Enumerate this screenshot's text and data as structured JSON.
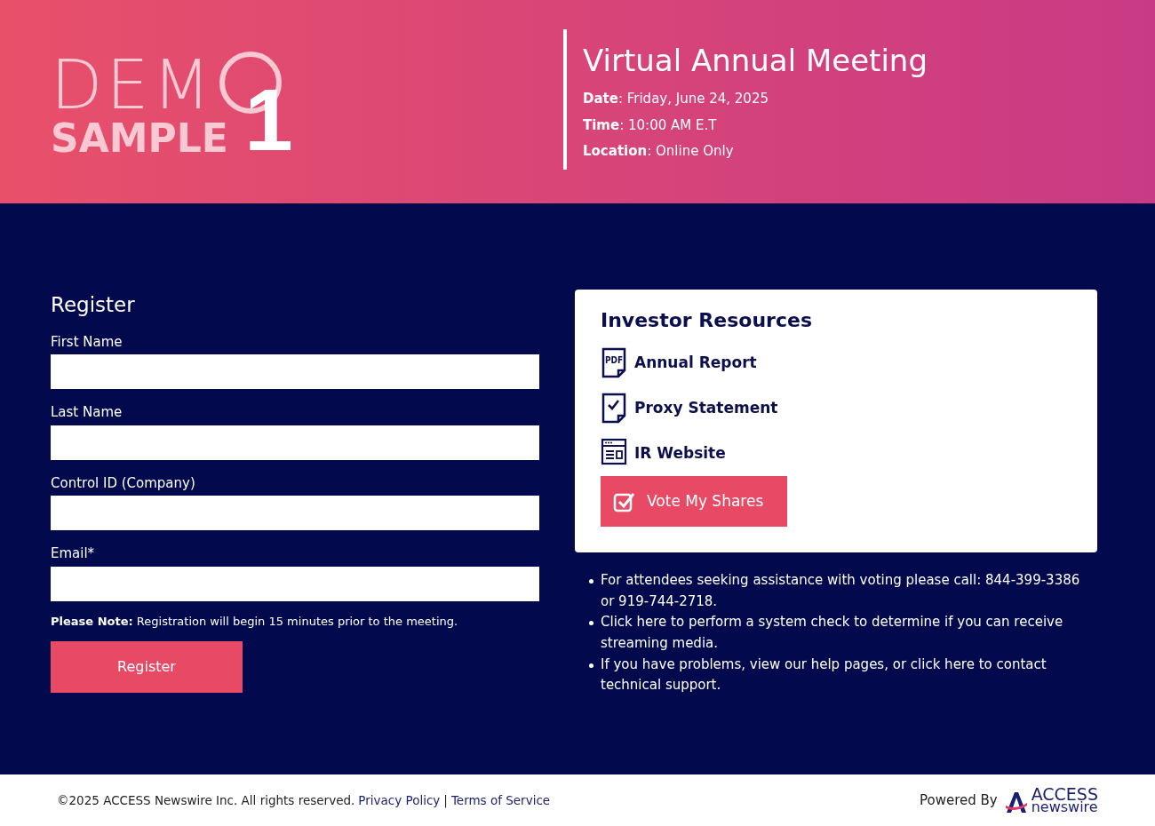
{
  "logo": {
    "line_1": "DEM",
    "numeral": "1",
    "line_2": "SAMPLE"
  },
  "meeting": {
    "title": "Virtual Annual Meeting",
    "details": [
      "**Date**: Friday, June 24, 2025",
      "**Time**: 10:00 AM E.T",
      "**Location**: Online Only"
    ]
  },
  "register": {
    "title": "Register",
    "fields": [
      {
        "label": "First Name"
      },
      {
        "label": "Last Name"
      },
      {
        "label": "Control ID (Company)"
      },
      {
        "label": "Email*"
      }
    ],
    "note": "**Please Note:** Registration will begin 15 minutes prior to the meeting.",
    "button": "Register"
  },
  "resources": {
    "title": "Investor Resources",
    "items": [
      {
        "kind": "pdf",
        "icon_text": "PDF",
        "label": "Annual Report"
      },
      {
        "kind": "checklist",
        "label": "Proxy Statement"
      },
      {
        "kind": "website",
        "label": "IR Website"
      }
    ],
    "vote_button": "Vote My Shares"
  },
  "notes": [
    "For attendees seeking assistance with voting please call: 844-399-3386 or 919-744-2718.",
    "Click here to perform a system check to determine if you can receive streaming media.",
    "If you have problems, view our help pages, or click here to contact technical support."
  ],
  "footer": {
    "copyright": "©2025 ACCESS Newswire Inc. All rights reserved.",
    "links": [
      "Privacy Policy",
      "Terms of Service"
    ],
    "separator": "|",
    "powered_by": "Powered By",
    "brand_top": "ACCESS",
    "brand_bottom": "newswire"
  }
}
